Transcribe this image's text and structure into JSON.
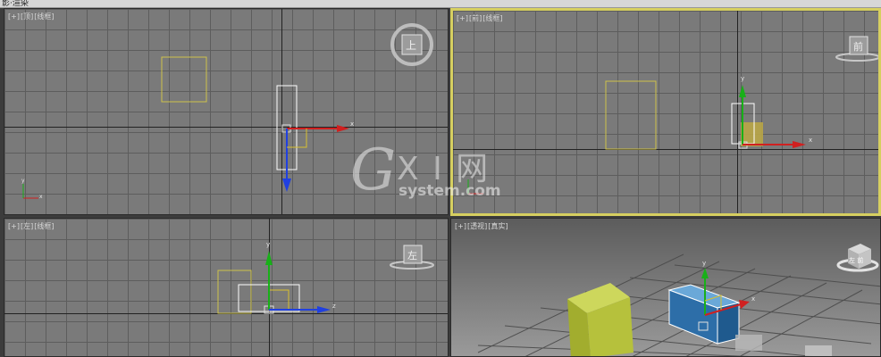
{
  "app": {
    "title_strip": "影·渲染"
  },
  "viewports": {
    "top": {
      "label_parts": [
        "[+]",
        "[顶]",
        "[线框]"
      ],
      "viewcube_face": "上",
      "axis_x": "x",
      "axis_y": "y"
    },
    "front": {
      "label_parts": [
        "[+]",
        "[前]",
        "[线框]"
      ],
      "viewcube_face": "前",
      "axis_x": "x",
      "axis_y": "y"
    },
    "left": {
      "label_parts": [
        "[+]",
        "[左]",
        "[线框]"
      ],
      "viewcube_face": "左",
      "axis_z": "z",
      "axis_y": "y"
    },
    "perspective": {
      "label_parts": [
        "[+]",
        "[透视]",
        "[真实]"
      ],
      "viewcube_face": "左 前",
      "axis_y": "y",
      "axis_x": "x"
    }
  },
  "watermark": {
    "logo_letter": "G",
    "logo_xi": "X I 网",
    "domain": "system.com"
  },
  "colors": {
    "grid_bg": "#7a7a7a",
    "active_border": "#d6cf60",
    "gizmo_x": "#d02020",
    "gizmo_y": "#18b018",
    "gizmo_z": "#2040e0",
    "selection": "#ffffff",
    "yellow_outline": "#cdc24a",
    "box_green": "#b5c23a",
    "box_blue": "#2d6ea8"
  }
}
